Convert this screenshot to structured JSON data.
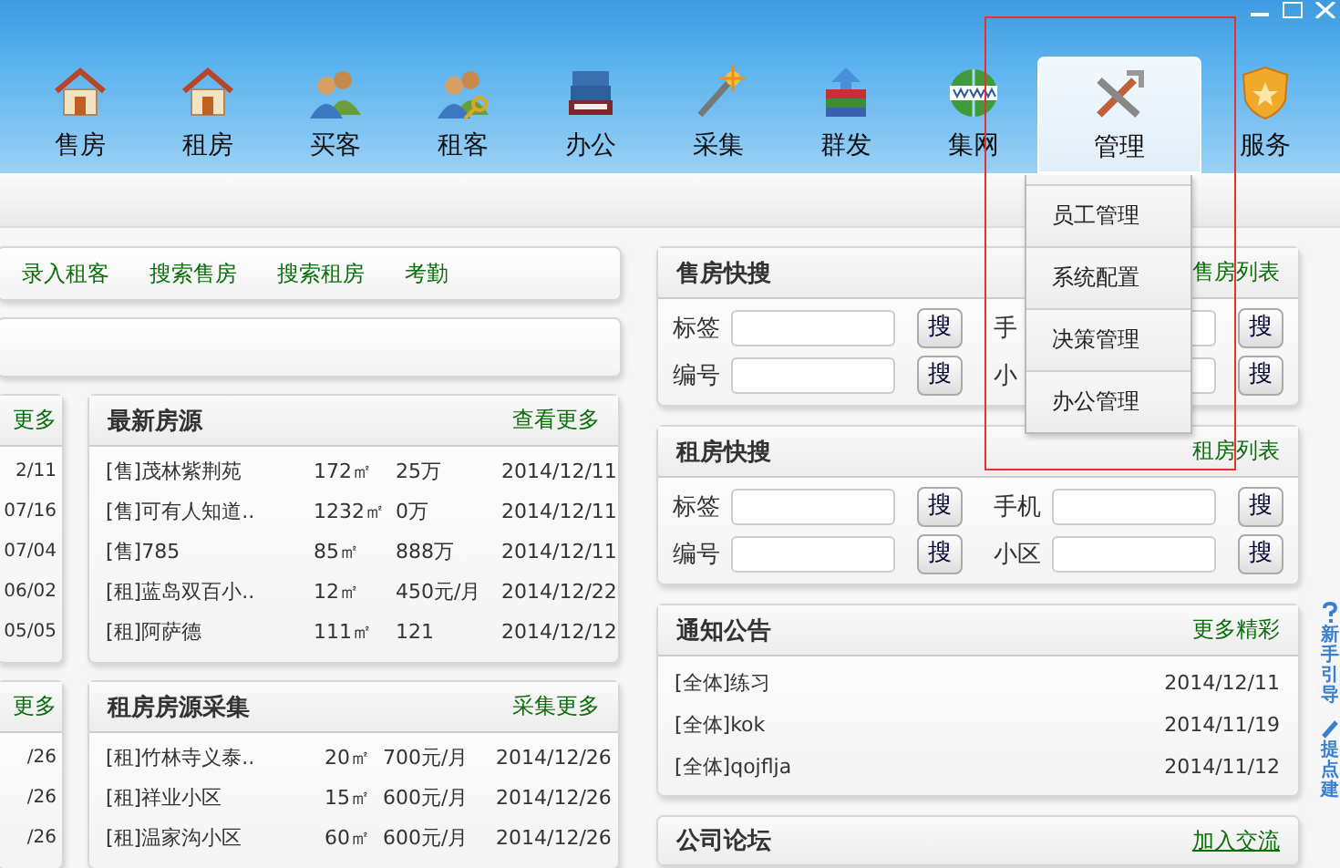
{
  "nav": [
    {
      "label": "售房",
      "selected": false
    },
    {
      "label": "租房",
      "selected": false
    },
    {
      "label": "买客",
      "selected": false
    },
    {
      "label": "租客",
      "selected": false
    },
    {
      "label": "办公",
      "selected": false
    },
    {
      "label": "采集",
      "selected": false
    },
    {
      "label": "群发",
      "selected": false
    },
    {
      "label": "集网",
      "selected": false
    },
    {
      "label": "管理",
      "selected": true
    },
    {
      "label": "服务",
      "selected": false
    }
  ],
  "admin_menu": [
    "员工管理",
    "系统配置",
    "决策管理",
    "办公管理"
  ],
  "quick_links": [
    "录入租客",
    "搜索售房",
    "搜索租房",
    "考勤"
  ],
  "left_partial_panels": [
    {
      "more": "更多",
      "dates": [
        "2/11",
        "07/16",
        "07/04",
        "06/02",
        "05/05"
      ]
    },
    {
      "more": "更多",
      "dates": [
        "/26",
        "/26",
        "/26"
      ]
    }
  ],
  "latest_listings": {
    "title": "最新房源",
    "more": "查看更多",
    "rows": [
      [
        "[售]茂林紫荆苑",
        "172㎡",
        "25万",
        "2014/12/11"
      ],
      [
        "[售]可有人知道..",
        "1232㎡",
        "0万",
        "2014/12/11"
      ],
      [
        "[售]785",
        "85㎡",
        "888万",
        "2014/12/11"
      ],
      [
        "[租]蓝岛双百小..",
        "12㎡",
        "450元/月",
        "2014/12/22"
      ],
      [
        "[租]阿萨德",
        "111㎡",
        "121",
        "2014/12/12"
      ]
    ]
  },
  "rental_collection": {
    "title": "租房房源采集",
    "more": "采集更多",
    "rows": [
      [
        "[租]竹林寺义泰..",
        "20㎡",
        "700元/月",
        "2014/12/26"
      ],
      [
        "[租]祥业小区",
        "15㎡",
        "600元/月",
        "2014/12/26"
      ],
      [
        "[租]温家沟小区",
        "60㎡",
        "600元/月",
        "2014/12/26"
      ]
    ]
  },
  "sale_search": {
    "title": "售房快搜",
    "link": "售房列表",
    "fields": [
      {
        "label": "标签",
        "button": "搜"
      },
      {
        "label": "手",
        "button": "搜"
      },
      {
        "label": "编号",
        "button": "搜"
      },
      {
        "label": "小",
        "button": "搜"
      }
    ]
  },
  "rent_search": {
    "title": "租房快搜",
    "link": "租房列表",
    "fields": [
      {
        "label": "标签",
        "button": "搜"
      },
      {
        "label": "手机",
        "button": "搜"
      },
      {
        "label": "编号",
        "button": "搜"
      },
      {
        "label": "小区",
        "button": "搜"
      }
    ]
  },
  "notices": {
    "title": "通知公告",
    "more": "更多精彩",
    "rows": [
      {
        "text": "[全体]练习",
        "date": "2014/12/11"
      },
      {
        "text": "[全体]kok",
        "date": "2014/11/19"
      },
      {
        "text": "[全体]qojflja",
        "date": "2014/11/12"
      }
    ]
  },
  "forum": {
    "title": "公司论坛",
    "link": "加入交流"
  },
  "side_tabs": [
    "新手引导",
    "提点建"
  ]
}
